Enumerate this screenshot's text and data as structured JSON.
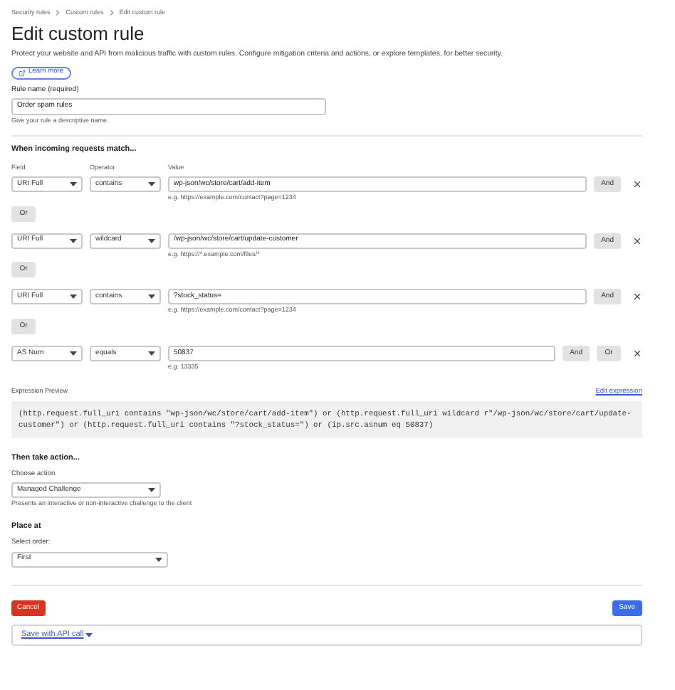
{
  "breadcrumbs": [
    "Security rules",
    "Custom rules",
    "Edit custom rule"
  ],
  "title": "Edit custom rule",
  "description": "Protect your website and API from malicious traffic with custom rules. Configure mitigation criteria and actions, or explore templates, for better security.",
  "learn_more": "Learn more",
  "rule_name": {
    "label": "Rule name (required)",
    "value": "Order spam rules",
    "hint": "Give your rule a descriptive name."
  },
  "conditions": {
    "heading": "When incoming requests match...",
    "column_labels": [
      "Field",
      "Operator",
      "Value"
    ],
    "rows": [
      {
        "field": "URI Full",
        "operator": "contains",
        "value": "wp-json/wc/store/cart/add-item",
        "example": "e.g. https://example.com/contact?page=1234",
        "actions": [
          "And"
        ],
        "below": "Or"
      },
      {
        "field": "URI Full",
        "operator": "wildcard",
        "value": "/wp-json/wc/store/cart/update-customer",
        "example": "e.g. https://*.example.com/files/*",
        "actions": [
          "And"
        ],
        "below": "Or"
      },
      {
        "field": "URI Full",
        "operator": "contains",
        "value": "?stock_status=",
        "example": "e.g. https://example.com/contact?page=1234",
        "actions": [
          "And"
        ],
        "below": "Or"
      },
      {
        "field": "AS Num",
        "operator": "equals",
        "value": "50837",
        "example": "e.g. 13335",
        "actions": [
          "And",
          "Or"
        ]
      }
    ]
  },
  "expression": {
    "label": "Expression Preview",
    "edit_link": "Edit expression",
    "code": "(http.request.full_uri contains \"wp-json/wc/store/cart/add-item\") or (http.request.full_uri wildcard r\"/wp-json/wc/store/cart/update-customer\") or (http.request.full_uri contains \"?stock_status=\") or (ip.src.asnum eq 50837)"
  },
  "action": {
    "heading": "Then take action...",
    "label": "Choose action",
    "value": "Managed Challenge",
    "hint": "Presents an interactive or non-interactive challenge to the client"
  },
  "place": {
    "heading": "Place at",
    "label": "Select order:",
    "value": "First"
  },
  "footer": {
    "cancel": "Cancel",
    "save": "Save",
    "api_link": "Save with API call"
  }
}
